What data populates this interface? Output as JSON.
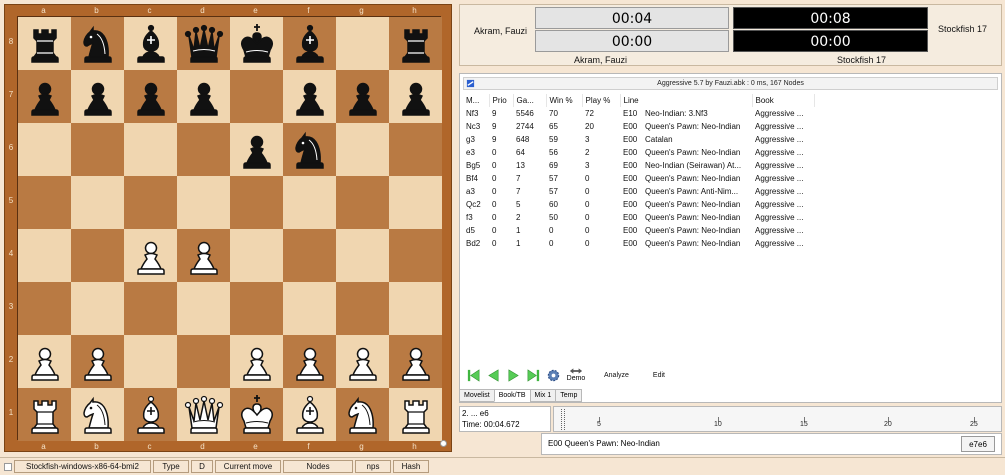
{
  "board": {
    "files": [
      "a",
      "b",
      "c",
      "d",
      "e",
      "f",
      "g",
      "h"
    ],
    "ranks": [
      "8",
      "7",
      "6",
      "5",
      "4",
      "3",
      "2",
      "1"
    ],
    "position": [
      [
        "bR",
        "bN",
        "bB",
        "bQ",
        "bK",
        "bB",
        "",
        "bR"
      ],
      [
        "bP",
        "bP",
        "bP",
        "bP",
        "",
        "bP",
        "bP",
        "bP"
      ],
      [
        "",
        "",
        "",
        "",
        "bP",
        "bN",
        "",
        ""
      ],
      [
        "",
        "",
        "",
        "",
        "",
        "",
        "",
        ""
      ],
      [
        "",
        "",
        "wP",
        "wP",
        "",
        "",
        "",
        ""
      ],
      [
        "",
        "",
        "",
        "",
        "",
        "",
        "",
        ""
      ],
      [
        "wP",
        "wP",
        "",
        "",
        "wP",
        "wP",
        "wP",
        "wP"
      ],
      [
        "wR",
        "wN",
        "wB",
        "wQ",
        "wK",
        "wB",
        "wN",
        "wR"
      ]
    ],
    "colors": {
      "light": "#f0d6b0",
      "dark": "#b97a43",
      "frame": "#b0662a"
    }
  },
  "clocks": {
    "white_player": "Akram, Fauzi",
    "black_player": "Stockfish 17",
    "white_time": "00:04",
    "white_move_time": "00:00",
    "black_time": "00:08",
    "black_move_time": "00:00",
    "white_name_bottom": "Akram, Fauzi",
    "black_name_bottom": "Stockfish 17"
  },
  "book": {
    "header": "Aggressive 5.7 by Fauzi.abk : 0 ms, 167 Nodes",
    "columns": [
      "M...",
      "Prio",
      "Ga...",
      "Win %",
      "Play %",
      "Line",
      "Book"
    ],
    "rows": [
      [
        "Nf3",
        "9",
        "5546",
        "70",
        "72",
        "E10",
        "Neo-Indian: 3.Nf3",
        "Aggressive ..."
      ],
      [
        "Nc3",
        "9",
        "2744",
        "65",
        "20",
        "E00",
        "Queen's Pawn: Neo-Indian",
        "Aggressive ..."
      ],
      [
        "g3",
        "9",
        "648",
        "59",
        "3",
        "E00",
        "Catalan",
        "Aggressive ..."
      ],
      [
        "e3",
        "0",
        "64",
        "56",
        "2",
        "E00",
        "Queen's Pawn: Neo-Indian",
        "Aggressive ..."
      ],
      [
        "Bg5",
        "0",
        "13",
        "69",
        "3",
        "E00",
        "Neo-Indian (Seirawan) At...",
        "Aggressive ..."
      ],
      [
        "Bf4",
        "0",
        "7",
        "57",
        "0",
        "E00",
        "Queen's Pawn: Neo-Indian",
        "Aggressive ..."
      ],
      [
        "a3",
        "0",
        "7",
        "57",
        "0",
        "E00",
        "Queen's Pawn: Anti-Nim...",
        "Aggressive ..."
      ],
      [
        "Qc2",
        "0",
        "5",
        "60",
        "0",
        "E00",
        "Queen's Pawn: Neo-Indian",
        "Aggressive ..."
      ],
      [
        "f3",
        "0",
        "2",
        "50",
        "0",
        "E00",
        "Queen's Pawn: Neo-Indian",
        "Aggressive ..."
      ],
      [
        "d5",
        "0",
        "1",
        "0",
        "0",
        "E00",
        "Queen's Pawn: Neo-Indian",
        "Aggressive ..."
      ],
      [
        "Bd2",
        "0",
        "1",
        "0",
        "0",
        "E00",
        "Queen's Pawn: Neo-Indian",
        "Aggressive ..."
      ]
    ],
    "toolbar": {
      "demo": "Demo",
      "analyze": "Analyze",
      "edit": "Edit"
    }
  },
  "tabs": [
    "Movelist",
    "Book/TB",
    "Mix 1",
    "Temp"
  ],
  "active_tab": "Book/TB",
  "move_info": {
    "last_move": "2. ... e6",
    "time": "Time: 00:04.672"
  },
  "timeline": {
    "ticks": [
      "5",
      "10",
      "15",
      "20",
      "25"
    ]
  },
  "opening": {
    "eco_name": "E00  Queen's Pawn: Neo-Indian",
    "square": "e7e6"
  },
  "status_bar": {
    "engine": "Stockfish-windows-x86-64-bmi2",
    "type_label": "Type",
    "type_value": "D",
    "current_move": "Current move",
    "nodes": "Nodes",
    "nps": "nps",
    "hash": "Hash"
  }
}
